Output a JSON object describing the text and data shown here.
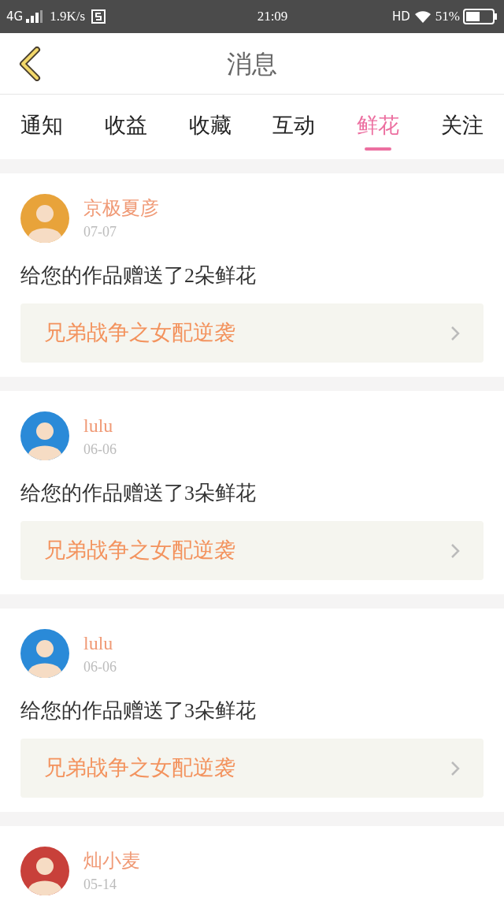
{
  "status_bar": {
    "network": "4G",
    "speed": "1.9K/s",
    "time": "21:09",
    "hd": "HD",
    "battery": "51%"
  },
  "header": {
    "title": "消息"
  },
  "tabs": [
    {
      "label": "通知",
      "selected": false
    },
    {
      "label": "收益",
      "selected": false
    },
    {
      "label": "收藏",
      "selected": false
    },
    {
      "label": "互动",
      "selected": false
    },
    {
      "label": "鲜花",
      "selected": true
    },
    {
      "label": "关注",
      "selected": false
    }
  ],
  "messages": [
    {
      "user": "京极夏彦",
      "date": "07-07",
      "text": "给您的作品赠送了2朵鲜花",
      "book": "兄弟战争之女配逆袭",
      "color": "#e8a33a"
    },
    {
      "user": "lulu",
      "date": "06-06",
      "text": "给您的作品赠送了3朵鲜花",
      "book": "兄弟战争之女配逆袭",
      "color": "#2a8ad8"
    },
    {
      "user": "lulu",
      "date": "06-06",
      "text": "给您的作品赠送了3朵鲜花",
      "book": "兄弟战争之女配逆袭",
      "color": "#2a8ad8"
    },
    {
      "user": "灿小麦",
      "date": "05-14",
      "color": "#c8403a"
    }
  ]
}
